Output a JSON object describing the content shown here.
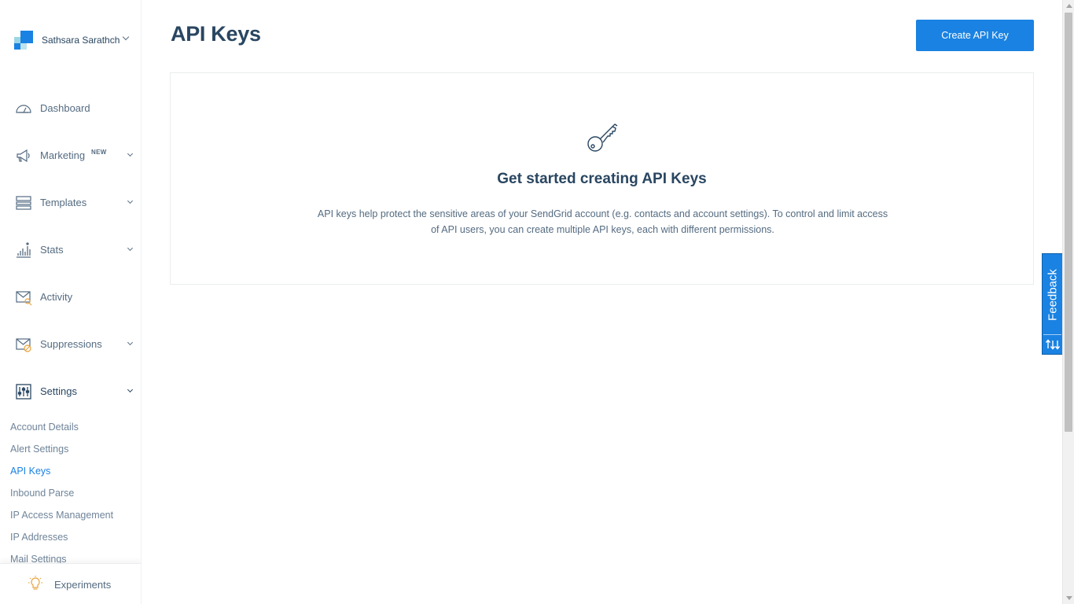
{
  "account": {
    "name": "Sathsara Sarathchandra"
  },
  "sidebar": {
    "items": [
      {
        "label": "Dashboard",
        "icon": "dashboard-gauge-icon"
      },
      {
        "label": "Marketing",
        "badge": "NEW",
        "icon": "megaphone-icon"
      },
      {
        "label": "Templates",
        "icon": "templates-icon"
      },
      {
        "label": "Stats",
        "icon": "stats-chart-icon"
      },
      {
        "label": "Activity",
        "icon": "activity-envelope-icon"
      },
      {
        "label": "Suppressions",
        "icon": "suppressions-envelope-icon"
      },
      {
        "label": "Settings",
        "icon": "settings-sliders-icon"
      }
    ],
    "settings_sub": [
      {
        "label": "Account Details"
      },
      {
        "label": "Alert Settings"
      },
      {
        "label": "API Keys",
        "active": true
      },
      {
        "label": "Inbound Parse"
      },
      {
        "label": "IP Access Management"
      },
      {
        "label": "IP Addresses"
      },
      {
        "label": "Mail Settings"
      }
    ],
    "experiments": {
      "label": "Experiments",
      "icon": "lightbulb-icon"
    }
  },
  "main": {
    "title": "API Keys",
    "create_button": "Create API Key",
    "empty_state": {
      "icon": "key-icon",
      "title": "Get started creating API Keys",
      "description": "API keys help protect the sensitive areas of your SendGrid account (e.g. contacts and account settings). To control and limit access of API users, you can create multiple API keys, each with different permissions."
    }
  },
  "feedback": {
    "label": "Feedback",
    "icon": "sort-arrows-icon"
  },
  "colors": {
    "accent": "#1a82e2",
    "text": "#294661",
    "muted": "#546b81"
  }
}
